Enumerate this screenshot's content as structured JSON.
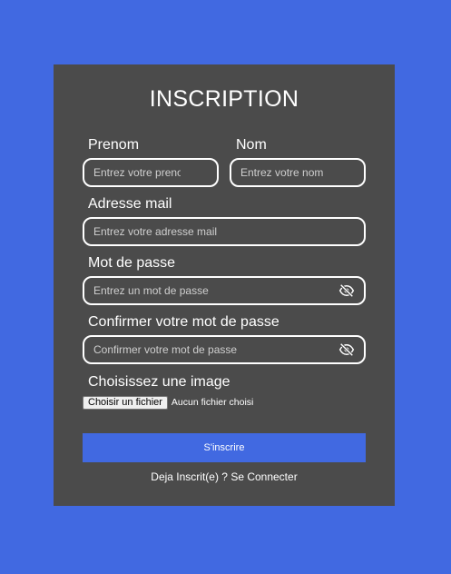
{
  "form": {
    "title": "INSCRIPTION",
    "firstname": {
      "label": "Prenom",
      "placeholder": "Entrez votre prenom",
      "value": ""
    },
    "lastname": {
      "label": "Nom",
      "placeholder": "Entrez votre nom",
      "value": ""
    },
    "email": {
      "label": "Adresse mail",
      "placeholder": "Entrez votre adresse mail",
      "value": ""
    },
    "password": {
      "label": "Mot de passe",
      "placeholder": "Entrez un mot de passe",
      "value": "",
      "toggle_icon": "eye-off-icon"
    },
    "confirm_password": {
      "label": "Confirmer votre mot de passe",
      "placeholder": "Confirmer votre mot de passe",
      "value": "",
      "toggle_icon": "eye-off-icon"
    },
    "image": {
      "label": "Choisissez une image",
      "button_label": "Choisir un fichier",
      "status": "Aucun fichier choisi"
    },
    "submit_label": "S'inscrire",
    "footer": {
      "prefix": "Deja Inscrit(e) ? ",
      "link": "Se Connecter"
    }
  },
  "colors": {
    "background": "#4169e1",
    "card": "#4b4b4b",
    "button": "#4169e1",
    "text": "#ffffff"
  }
}
